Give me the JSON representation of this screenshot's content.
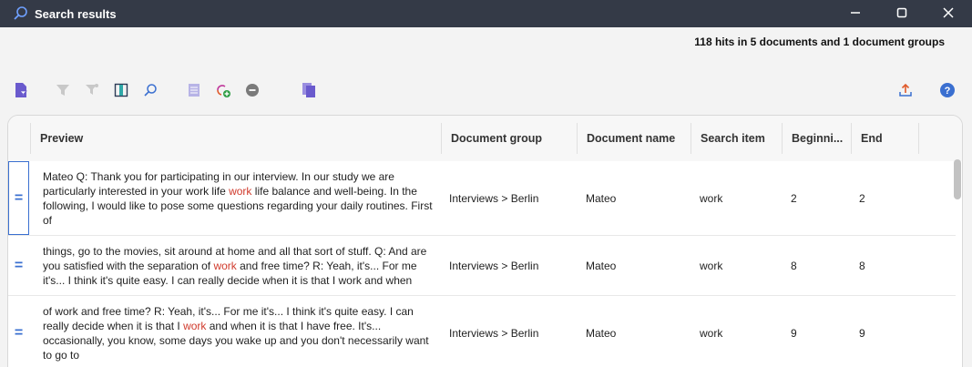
{
  "window": {
    "title": "Search results",
    "minimize_icon": "minimize-icon",
    "maximize_icon": "maximize-icon",
    "close_icon": "close-icon"
  },
  "summary": "118 hits in 5 documents and 1 document groups",
  "toolbar": {
    "icons": [
      "document-filter-icon",
      "filter-icon",
      "filter-settings-icon",
      "columns-icon",
      "search-icon",
      "document-list-icon",
      "add-code-icon",
      "remove-icon",
      "copy-documents-icon",
      "export-icon",
      "help-icon"
    ]
  },
  "columns": {
    "preview": "Preview",
    "document_group": "Document group",
    "document_name": "Document name",
    "search_item": "Search item",
    "beginning": "Beginni...",
    "end": "End"
  },
  "rows": [
    {
      "marker": "=",
      "preview_before": " Mateo  Q: Thank you for participating in our interview. In our study we are particularly interested in your work life ",
      "preview_hit": "work",
      "preview_after": " life balance and well-being. In the following, I would like to pose some questions regarding your daily routines. First of",
      "document_group": "Interviews > Berlin",
      "document_name": "Mateo",
      "search_item": "work",
      "beginning": "2",
      "end": "2"
    },
    {
      "marker": "=",
      "preview_before": " things, go to the movies, sit around at home and all that sort of stuff.  Q: And are you satisfied with the separation of ",
      "preview_hit": "work",
      "preview_after": " and free time?  R: Yeah, it's... For me it's... I think it's quite easy. I can really decide when it is that I work and when",
      "document_group": "Interviews > Berlin",
      "document_name": "Mateo",
      "search_item": "work",
      "beginning": "8",
      "end": "8"
    },
    {
      "marker": "=",
      "preview_before": " of work and free time?  R: Yeah, it's... For me it's... I think it's quite easy. I can really decide when it is that I ",
      "preview_hit": "work",
      "preview_after": " and when it is that I have free. It's... occasionally, you know, some days you wake up and you don't necessarily want to go to",
      "document_group": "Interviews > Berlin",
      "document_name": "Mateo",
      "search_item": "work",
      "beginning": "9",
      "end": "9"
    }
  ],
  "colors": {
    "titlebar": "#343a47",
    "accent": "#3a6fd0",
    "hit": "#d03a2c",
    "purple_icon": "#6a5acd"
  }
}
